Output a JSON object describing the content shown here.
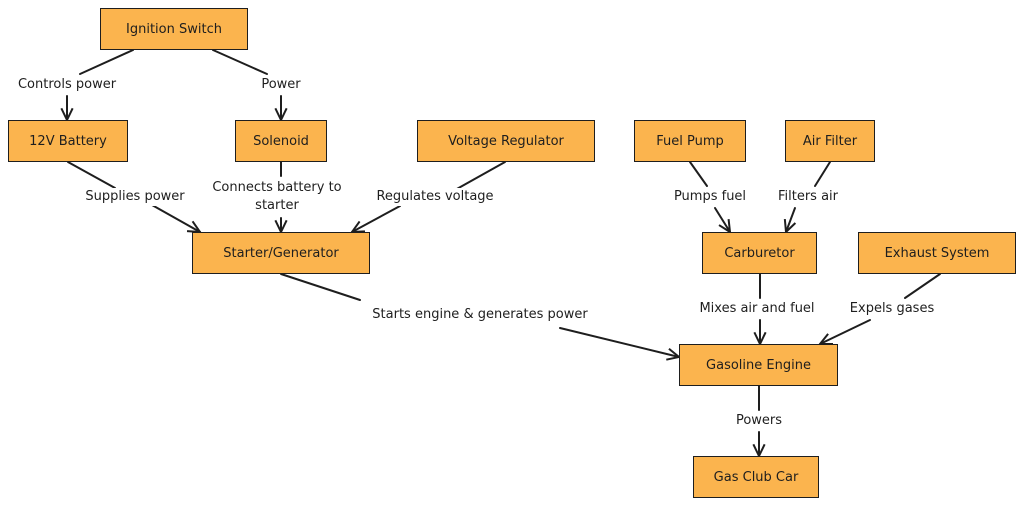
{
  "colors": {
    "node_fill": "#fbb44e",
    "stroke": "#1e1e1e"
  },
  "nodes": [
    {
      "id": "ignition",
      "label": "Ignition Switch"
    },
    {
      "id": "battery",
      "label": "12V Battery"
    },
    {
      "id": "solenoid",
      "label": "Solenoid"
    },
    {
      "id": "regulator",
      "label": "Voltage Regulator"
    },
    {
      "id": "fuelpump",
      "label": "Fuel Pump"
    },
    {
      "id": "airfilter",
      "label": "Air Filter"
    },
    {
      "id": "starter",
      "label": "Starter/Generator"
    },
    {
      "id": "carburetor",
      "label": "Carburetor"
    },
    {
      "id": "exhaust",
      "label": "Exhaust System"
    },
    {
      "id": "engine",
      "label": "Gasoline Engine"
    },
    {
      "id": "car",
      "label": "Gas Club Car"
    }
  ],
  "edges": [
    {
      "from": "ignition",
      "to": "battery",
      "label": "Controls power"
    },
    {
      "from": "ignition",
      "to": "solenoid",
      "label": "Power"
    },
    {
      "from": "battery",
      "to": "starter",
      "label": "Supplies power"
    },
    {
      "from": "solenoid",
      "to": "starter",
      "label": "Connects battery to\nstarter"
    },
    {
      "from": "regulator",
      "to": "starter",
      "label": "Regulates voltage"
    },
    {
      "from": "fuelpump",
      "to": "carburetor",
      "label": "Pumps fuel"
    },
    {
      "from": "airfilter",
      "to": "carburetor",
      "label": "Filters air"
    },
    {
      "from": "starter",
      "to": "engine",
      "label": "Starts engine & generates power"
    },
    {
      "from": "carburetor",
      "to": "engine",
      "label": "Mixes air and fuel"
    },
    {
      "from": "exhaust",
      "to": "engine",
      "label": "Expels gases"
    },
    {
      "from": "engine",
      "to": "car",
      "label": "Powers"
    }
  ]
}
